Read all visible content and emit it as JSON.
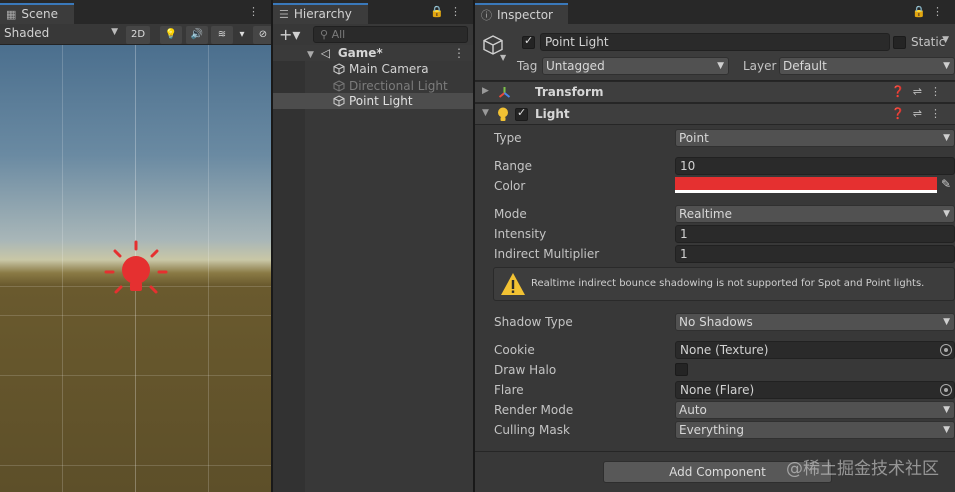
{
  "scene": {
    "tab": "Scene",
    "shading_mode": "Shaded",
    "btn_2d": "2D"
  },
  "hierarchy": {
    "tab": "Hierarchy",
    "add_label": "+▾",
    "search_placeholder": "All",
    "items": [
      {
        "label": "Game*"
      },
      {
        "label": "Main Camera"
      },
      {
        "label": "Directional Light"
      },
      {
        "label": "Point Light"
      }
    ]
  },
  "inspector": {
    "tab": "Inspector",
    "object_name": "Point Light",
    "static_label": "Static",
    "tag_label": "Tag",
    "tag_value": "Untagged",
    "layer_label": "Layer",
    "layer_value": "Default",
    "transform_title": "Transform",
    "light_title": "Light",
    "props": {
      "type_label": "Type",
      "type_value": "Point",
      "range_label": "Range",
      "range_value": "10",
      "color_label": "Color",
      "mode_label": "Mode",
      "mode_value": "Realtime",
      "intensity_label": "Intensity",
      "intensity_value": "1",
      "indirect_label": "Indirect Multiplier",
      "indirect_value": "1",
      "warning": "Realtime indirect bounce shadowing is not supported for Spot and Point lights.",
      "shadow_label": "Shadow Type",
      "shadow_value": "No Shadows",
      "cookie_label": "Cookie",
      "cookie_value": "None (Texture)",
      "halo_label": "Draw Halo",
      "flare_label": "Flare",
      "flare_value": "None (Flare)",
      "render_label": "Render Mode",
      "render_value": "Auto",
      "culling_label": "Culling Mask",
      "culling_value": "Everything"
    },
    "add_component": "Add Component"
  },
  "watermark": "@稀土掘金技术社区",
  "colors": {
    "light_color": "#e53030",
    "selection_accent": "#3a79bb"
  }
}
